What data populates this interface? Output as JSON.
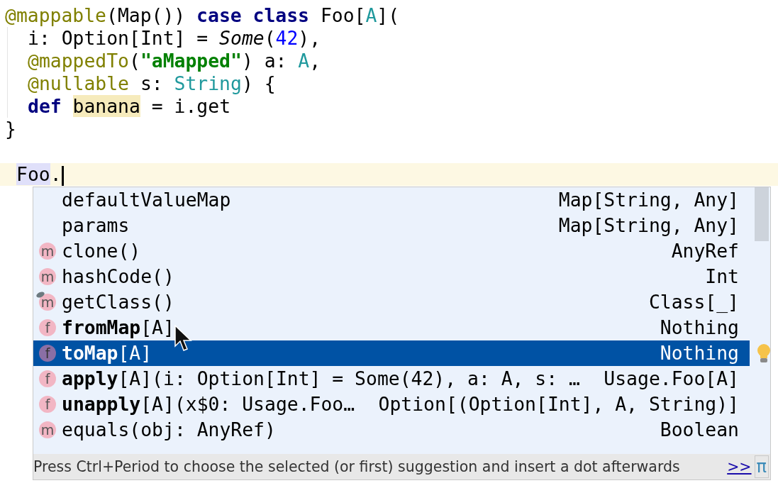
{
  "code_lines": [
    {
      "indented": false,
      "tokens": [
        {
          "text": "@mappable",
          "kind": "annotation"
        },
        {
          "text": "(Map()) ",
          "kind": "plain"
        },
        {
          "text": "case class",
          "kind": "keyword"
        },
        {
          "text": " Foo[",
          "kind": "plain"
        },
        {
          "text": "A",
          "kind": "type"
        },
        {
          "text": "](",
          "kind": "plain"
        }
      ]
    },
    {
      "indented": true,
      "tokens": [
        {
          "text": "i: Option[Int] = ",
          "kind": "plain"
        },
        {
          "text": "Some",
          "kind": "italic"
        },
        {
          "text": "(",
          "kind": "plain"
        },
        {
          "text": "42",
          "kind": "number"
        },
        {
          "text": "),",
          "kind": "plain"
        }
      ]
    },
    {
      "indented": true,
      "tokens": [
        {
          "text": "@mappedTo",
          "kind": "annotation"
        },
        {
          "text": "(",
          "kind": "plain"
        },
        {
          "text": "\"aMapped\"",
          "kind": "string"
        },
        {
          "text": ") a: ",
          "kind": "plain"
        },
        {
          "text": "A",
          "kind": "type"
        },
        {
          "text": ",",
          "kind": "plain"
        }
      ]
    },
    {
      "indented": true,
      "tokens": [
        {
          "text": "@nullable",
          "kind": "annotation"
        },
        {
          "text": " s: ",
          "kind": "plain"
        },
        {
          "text": "String",
          "kind": "type"
        },
        {
          "text": ") {",
          "kind": "plain"
        }
      ]
    },
    {
      "indented": true,
      "tokens": [
        {
          "text": "def ",
          "kind": "keyword"
        },
        {
          "text": "banana",
          "kind": "highlight"
        },
        {
          "text": " = i.get",
          "kind": "plain"
        }
      ]
    },
    {
      "indented": false,
      "tokens": [
        {
          "text": "}",
          "kind": "plain"
        }
      ]
    }
  ],
  "input_line": {
    "current": true,
    "tokens": [
      {
        "text": "Foo",
        "kind": "reference"
      },
      {
        "text": ".",
        "kind": "plain"
      }
    ]
  },
  "completions": [
    {
      "kind": "field",
      "signature": "defaultValueMap",
      "type": "Map[String, Any]",
      "selected": false,
      "pinned": false,
      "bulb": false
    },
    {
      "kind": "field",
      "signature": "params",
      "type": "Map[String, Any]",
      "selected": false,
      "pinned": false,
      "bulb": false
    },
    {
      "icon": "m",
      "kind": "method",
      "signature": "clone()",
      "type": "AnyRef",
      "selected": false,
      "pinned": false,
      "bulb": false
    },
    {
      "icon": "m",
      "kind": "method",
      "signature": "hashCode()",
      "type": "Int",
      "selected": false,
      "pinned": false,
      "bulb": false
    },
    {
      "icon": "m",
      "kind": "method",
      "signature": "getClass()",
      "type": "Class[_]",
      "selected": false,
      "pinned": true,
      "bulb": false
    },
    {
      "icon": "f",
      "kind": "function",
      "signature": "**fromMap**[A]",
      "type": "Nothing",
      "selected": false,
      "pinned": false,
      "bulb": false
    },
    {
      "icon": "f",
      "kind": "function",
      "signature": "**toMap**[A]",
      "type": "Nothing",
      "selected": true,
      "pinned": false,
      "bulb": true
    },
    {
      "icon": "f",
      "kind": "function",
      "signature": "**apply**[A](i: Option[Int] = Some(42), a: A, s: …",
      "type": "Usage.Foo[A]",
      "selected": false,
      "pinned": false,
      "bulb": false
    },
    {
      "icon": "f",
      "kind": "function",
      "signature": "**unapply**[A](x$0: Usage.Foo…",
      "type": "Option[(Option[Int], A, String)]",
      "selected": false,
      "pinned": false,
      "bulb": false
    },
    {
      "icon": "m",
      "kind": "method",
      "signature": "equals(obj: AnyRef)",
      "type": "Boolean",
      "selected": false,
      "pinned": false,
      "bulb": false
    }
  ],
  "footer": {
    "hint": "Press Ctrl+Period to choose the selected (or first) suggestion and insert a dot afterwards",
    "link": ">>",
    "button": "π"
  }
}
